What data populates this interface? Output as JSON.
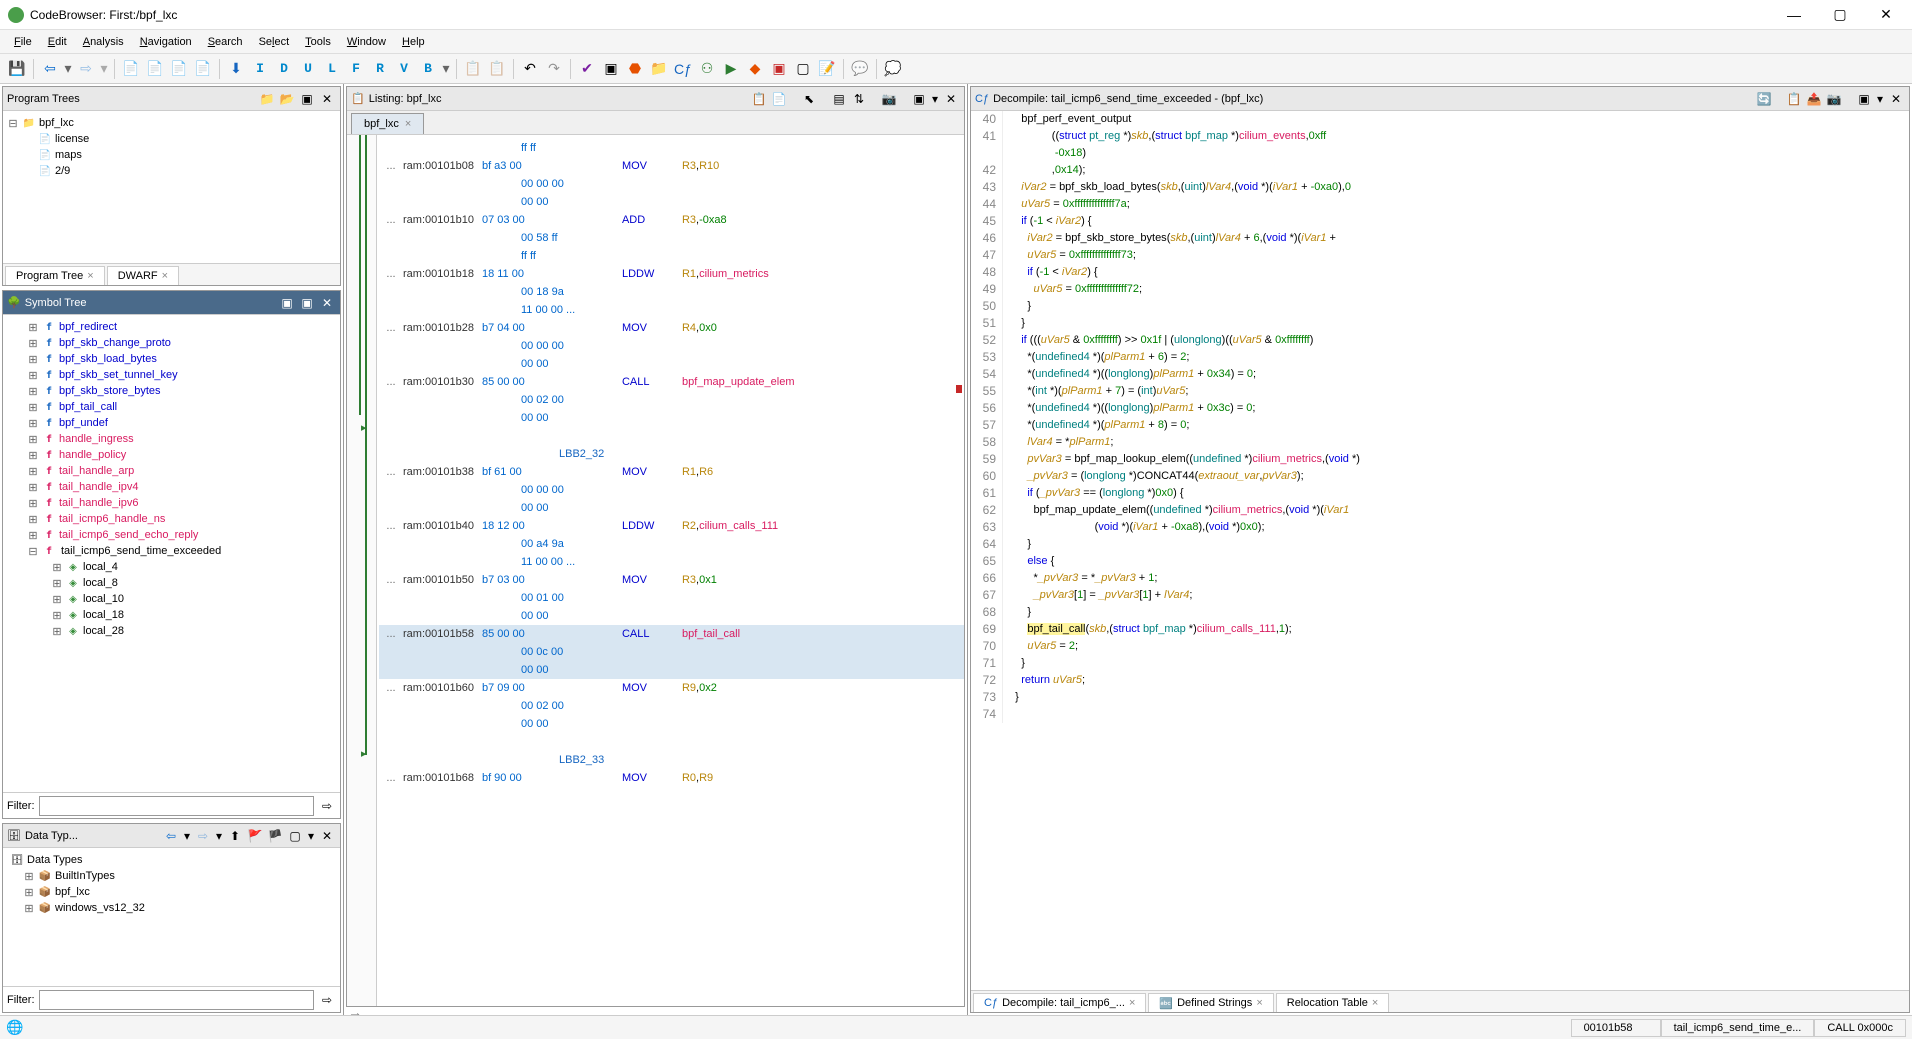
{
  "title": "CodeBrowser: First:/bpf_lxc",
  "menus": [
    "File",
    "Edit",
    "Analysis",
    "Navigation",
    "Search",
    "Select",
    "Tools",
    "Window",
    "Help"
  ],
  "program_trees": {
    "title": "Program Trees",
    "root": "bpf_lxc",
    "items": [
      "license",
      "maps",
      "2/9"
    ],
    "tabs": [
      "Program Tree",
      "DWARF"
    ]
  },
  "symbol_tree": {
    "title": "Symbol Tree",
    "functions_blue": [
      "bpf_redirect",
      "bpf_skb_change_proto",
      "bpf_skb_load_bytes",
      "bpf_skb_set_tunnel_key",
      "bpf_skb_store_bytes",
      "bpf_tail_call",
      "bpf_undef"
    ],
    "functions_mag": [
      "handle_ingress",
      "handle_policy",
      "tail_handle_arp",
      "tail_handle_ipv4",
      "tail_handle_ipv6",
      "tail_icmp6_handle_ns",
      "tail_icmp6_send_echo_reply"
    ],
    "selected": "tail_icmp6_send_time_exceeded",
    "locals": [
      "local_4",
      "local_8",
      "local_10",
      "local_18",
      "local_28"
    ],
    "filter_label": "Filter:"
  },
  "data_types": {
    "title": "Data Typ...",
    "root": "Data Types",
    "items": [
      "BuiltInTypes",
      "bpf_lxc",
      "windows_vs12_32"
    ],
    "filter_label": "Filter:"
  },
  "listing": {
    "title": "Listing: bpf_lxc",
    "tab": "bpf_lxc",
    "rows": [
      {
        "type": "cont",
        "bytes": "ff ff"
      },
      {
        "addr": "ram:00101b08",
        "bytes": "bf a3 00",
        "mne": "MOV",
        "op": "R3,R10",
        "r": true
      },
      {
        "type": "cont",
        "bytes": "00 00 00"
      },
      {
        "type": "cont",
        "bytes": "00 00"
      },
      {
        "addr": "ram:00101b10",
        "bytes": "07 03 00",
        "mne": "ADD",
        "op": "R3,-0xa8",
        "r": true,
        "imm": true
      },
      {
        "type": "cont",
        "bytes": "00 58 ff"
      },
      {
        "type": "cont",
        "bytes": "ff ff"
      },
      {
        "addr": "ram:00101b18",
        "bytes": "18 11 00",
        "mne": "LDDW",
        "op": "R1,cilium_metrics",
        "r": true,
        "sym": true
      },
      {
        "type": "cont",
        "bytes": "00 18 9a"
      },
      {
        "type": "cont",
        "bytes": "11 00 00 ...",
        "ell": true
      },
      {
        "addr": "ram:00101b28",
        "bytes": "b7 04 00",
        "mne": "MOV",
        "op": "R4,0x0",
        "r": true,
        "imm": true
      },
      {
        "type": "cont",
        "bytes": "00 00 00"
      },
      {
        "type": "cont",
        "bytes": "00 00"
      },
      {
        "addr": "ram:00101b30",
        "bytes": "85 00 00",
        "mne": "CALL",
        "op": "bpf_map_update_elem",
        "sym": true
      },
      {
        "type": "cont",
        "bytes": "00 02 00"
      },
      {
        "type": "cont",
        "bytes": "00 00"
      },
      {
        "type": "blank"
      },
      {
        "type": "label",
        "text": "LBB2_32"
      },
      {
        "addr": "ram:00101b38",
        "bytes": "bf 61 00",
        "mne": "MOV",
        "op": "R1,R6",
        "r": true
      },
      {
        "type": "cont",
        "bytes": "00 00 00"
      },
      {
        "type": "cont",
        "bytes": "00 00"
      },
      {
        "addr": "ram:00101b40",
        "bytes": "18 12 00",
        "mne": "LDDW",
        "op": "R2,cilium_calls_111",
        "r": true,
        "sym": true
      },
      {
        "type": "cont",
        "bytes": "00 a4 9a"
      },
      {
        "type": "cont",
        "bytes": "11 00 00 ...",
        "ell": true
      },
      {
        "addr": "ram:00101b50",
        "bytes": "b7 03 00",
        "mne": "MOV",
        "op": "R3,0x1",
        "r": true,
        "imm": true
      },
      {
        "type": "cont",
        "bytes": "00 01 00"
      },
      {
        "type": "cont",
        "bytes": "00 00"
      },
      {
        "addr": "ram:00101b58",
        "bytes": "85 00 00",
        "mne": "CALL",
        "op": "bpf_tail_call",
        "sym": true,
        "hl": true
      },
      {
        "type": "cont",
        "bytes": "00 0c 00",
        "hl": true
      },
      {
        "type": "cont",
        "bytes": "00 00",
        "hl": true
      },
      {
        "addr": "ram:00101b60",
        "bytes": "b7 09 00",
        "mne": "MOV",
        "op": "R9,0x2",
        "r": true,
        "imm": true
      },
      {
        "type": "cont",
        "bytes": "00 02 00"
      },
      {
        "type": "cont",
        "bytes": "00 00"
      },
      {
        "type": "blank"
      },
      {
        "type": "label",
        "text": "LBB2_33"
      },
      {
        "addr": "ram:00101b68",
        "bytes": "bf 90 00",
        "mne": "MOV",
        "op": "R0,R9",
        "r": true
      }
    ]
  },
  "decompile": {
    "title": "Decompile: tail_icmp6_send_time_exceeded -  (bpf_lxc)",
    "tabs": [
      "Decompile: tail_icmp6_...",
      "Defined Strings",
      "Relocation Table"
    ],
    "lines": [
      {
        "n": 40,
        "html": "    <span class='fn'>bpf_perf_event_output</span>"
      },
      {
        "n": 41,
        "html": "              ((<span class='kw'>struct</span> <span class='typ'>pt_reg</span> *)<span class='ident'>skb</span>,(<span class='kw'>struct</span> <span class='typ'>bpf_map</span> *)<span class='sym'>cilium_events</span>,<span class='num'>0xff</span>"
      },
      {
        "n": "",
        "html": "               <span class='num'>-0x18</span>)"
      },
      {
        "n": 42,
        "html": "              ,<span class='num'>0x14</span>);"
      },
      {
        "n": 43,
        "html": "    <span class='ident'>iVar2</span> = <span class='fn'>bpf_skb_load_bytes</span>(<span class='ident'>skb</span>,(<span class='typ'>uint</span>)<span class='ident'>lVar4</span>,(<span class='kw'>void</span> *)(<span class='ident'>iVar1</span> + <span class='num'>-0xa0</span>),<span class='num'>0</span>"
      },
      {
        "n": 44,
        "html": "    <span class='ident'>uVar5</span> = <span class='num'>0xffffffffffffff7a</span>;"
      },
      {
        "n": 45,
        "html": "    <span class='kw'>if</span> (<span class='num'>-1</span> &lt; <span class='ident'>iVar2</span>) {"
      },
      {
        "n": 46,
        "html": "      <span class='ident'>iVar2</span> = <span class='fn'>bpf_skb_store_bytes</span>(<span class='ident'>skb</span>,(<span class='typ'>uint</span>)<span class='ident'>lVar4</span> + <span class='num'>6</span>,(<span class='kw'>void</span> *)(<span class='ident'>iVar1</span> + "
      },
      {
        "n": 47,
        "html": "      <span class='ident'>uVar5</span> = <span class='num'>0xffffffffffffff73</span>;"
      },
      {
        "n": 48,
        "html": "      <span class='kw'>if</span> (<span class='num'>-1</span> &lt; <span class='ident'>iVar2</span>) {"
      },
      {
        "n": 49,
        "html": "        <span class='ident'>uVar5</span> = <span class='num'>0xffffffffffffff72</span>;"
      },
      {
        "n": 50,
        "html": "      }"
      },
      {
        "n": 51,
        "html": "    }"
      },
      {
        "n": 52,
        "html": "    <span class='kw'>if</span> (((<span class='ident'>uVar5</span> &amp; <span class='num'>0xffffffff</span>) &gt;&gt; <span class='num'>0x1f</span> | (<span class='typ'>ulonglong</span>)((<span class='ident'>uVar5</span> &amp; <span class='num'>0xffffffff</span>)"
      },
      {
        "n": 53,
        "html": "      *(<span class='typ'>undefined4</span> *)(<span class='ident'>plParm1</span> + <span class='num'>6</span>) = <span class='num'>2</span>;"
      },
      {
        "n": 54,
        "html": "      *(<span class='typ'>undefined4</span> *)((<span class='typ'>longlong</span>)<span class='ident'>plParm1</span> + <span class='num'>0x34</span>) = <span class='num'>0</span>;"
      },
      {
        "n": 55,
        "html": "      *(<span class='typ'>int</span> *)(<span class='ident'>plParm1</span> + <span class='num'>7</span>) = (<span class='typ'>int</span>)<span class='ident'>uVar5</span>;"
      },
      {
        "n": 56,
        "html": "      *(<span class='typ'>undefined4</span> *)((<span class='typ'>longlong</span>)<span class='ident'>plParm1</span> + <span class='num'>0x3c</span>) = <span class='num'>0</span>;"
      },
      {
        "n": 57,
        "html": "      *(<span class='typ'>undefined4</span> *)(<span class='ident'>plParm1</span> + <span class='num'>8</span>) = <span class='num'>0</span>;"
      },
      {
        "n": 58,
        "html": "      <span class='ident'>lVar4</span> = *<span class='ident'>plParm1</span>;"
      },
      {
        "n": 59,
        "html": "      <span class='ident'>pvVar3</span> = <span class='fn'>bpf_map_lookup_elem</span>((<span class='typ'>undefined</span> *)<span class='sym'>cilium_metrics</span>,(<span class='kw'>void</span> *)"
      },
      {
        "n": 60,
        "html": "      <span class='ident'>_pvVar3</span> = (<span class='typ'>longlong</span> *)<span class='fn'>CONCAT44</span>(<span class='ident'>extraout_var</span>,<span class='ident'>pvVar3</span>);"
      },
      {
        "n": 61,
        "html": "      <span class='kw'>if</span> (<span class='ident'>_pvVar3</span> == (<span class='typ'>longlong</span> *)<span class='num'>0x0</span>) {"
      },
      {
        "n": 62,
        "html": "        <span class='fn'>bpf_map_update_elem</span>((<span class='typ'>undefined</span> *)<span class='sym'>cilium_metrics</span>,(<span class='kw'>void</span> *)(<span class='ident'>iVar1</span> "
      },
      {
        "n": 63,
        "html": "                            (<span class='kw'>void</span> *)(<span class='ident'>iVar1</span> + <span class='num'>-0xa8</span>),(<span class='kw'>void</span> *)<span class='num'>0x0</span>);"
      },
      {
        "n": 64,
        "html": "      }"
      },
      {
        "n": 65,
        "html": "      <span class='kw'>else</span> {"
      },
      {
        "n": 66,
        "html": "        *<span class='ident'>_pvVar3</span> = *<span class='ident'>_pvVar3</span> + <span class='num'>1</span>;"
      },
      {
        "n": 67,
        "html": "        <span class='ident'>_pvVar3</span>[<span class='num'>1</span>] = <span class='ident'>_pvVar3</span>[<span class='num'>1</span>] + <span class='ident'>lVar4</span>;"
      },
      {
        "n": 68,
        "html": "      }"
      },
      {
        "n": 69,
        "html": "      <span class='hl-call'><span class='fn'>bpf_tail_call</span></span>(<span class='ident'>skb</span>,(<span class='kw'>struct</span> <span class='typ'>bpf_map</span> *)<span class='sym'>cilium_calls_111</span>,<span class='num'>1</span>);"
      },
      {
        "n": 70,
        "html": "      <span class='ident'>uVar5</span> = <span class='num'>2</span>;"
      },
      {
        "n": 71,
        "html": "    }"
      },
      {
        "n": 72,
        "html": "    <span class='kw'>return</span> <span class='ident'>uVar5</span>;"
      },
      {
        "n": 73,
        "html": "  }"
      },
      {
        "n": 74,
        "html": ""
      }
    ]
  },
  "status": {
    "addr": "00101b58",
    "func": "tail_icmp6_send_time_e...",
    "call": "CALL 0x000c"
  }
}
